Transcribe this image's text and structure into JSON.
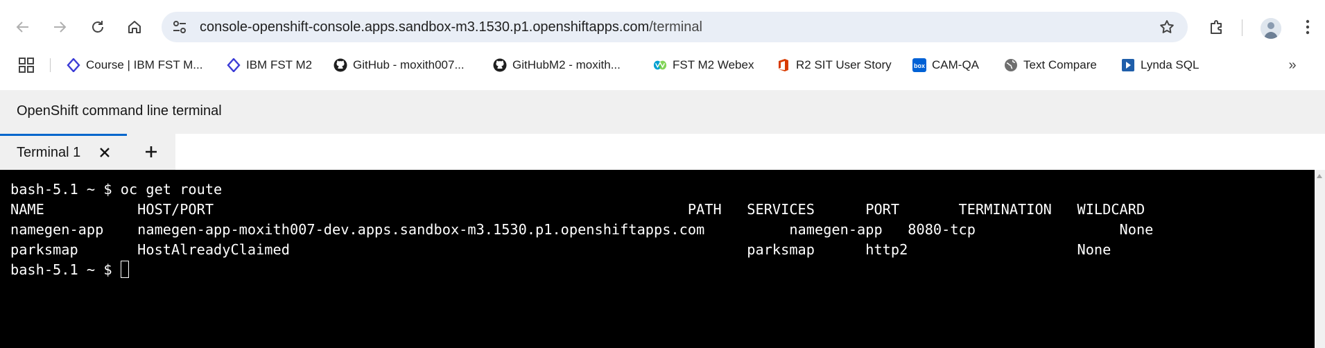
{
  "browser": {
    "url_host": "console-openshift-console.apps.sandbox-m3.1530.p1.openshiftapps.com",
    "url_path": "/terminal"
  },
  "bookmarks": [
    {
      "label": "Course | IBM FST M...",
      "icon": "diamond-icon"
    },
    {
      "label": "IBM FST M2",
      "icon": "diamond-icon"
    },
    {
      "label": "GitHub - moxith007...",
      "icon": "github-icon"
    },
    {
      "label": "GitHubM2 - moxith...",
      "icon": "github-icon"
    },
    {
      "label": "FST M2 Webex",
      "icon": "webex-icon"
    },
    {
      "label": "R2 SIT User Story",
      "icon": "office-icon"
    },
    {
      "label": "CAM-QA",
      "icon": "box-icon"
    },
    {
      "label": "Text Compare",
      "icon": "globe-icon"
    },
    {
      "label": "Lynda SQL",
      "icon": "play-icon"
    }
  ],
  "app": {
    "title": "OpenShift command line terminal"
  },
  "tabs": [
    {
      "label": "Terminal 1"
    }
  ],
  "terminal": {
    "lines": [
      "bash-5.1 ~ $ oc get route",
      "NAME           HOST/PORT                                                        PATH   SERVICES      PORT       TERMINATION   WILDCARD",
      "namegen-app    namegen-app-moxith007-dev.apps.sandbox-m3.1530.p1.openshiftapps.com          namegen-app   8080-tcp                 None",
      "parksmap       HostAlreadyClaimed                                                      parksmap      http2                    None"
    ],
    "prompt": "bash-5.1 ~ $ "
  },
  "colors": {
    "accent": "#0066cc",
    "terminal_bg": "#000000",
    "terminal_fg": "#ffffff",
    "header_bg": "#f0f0f0",
    "omnibox_bg": "#e9eef6"
  }
}
